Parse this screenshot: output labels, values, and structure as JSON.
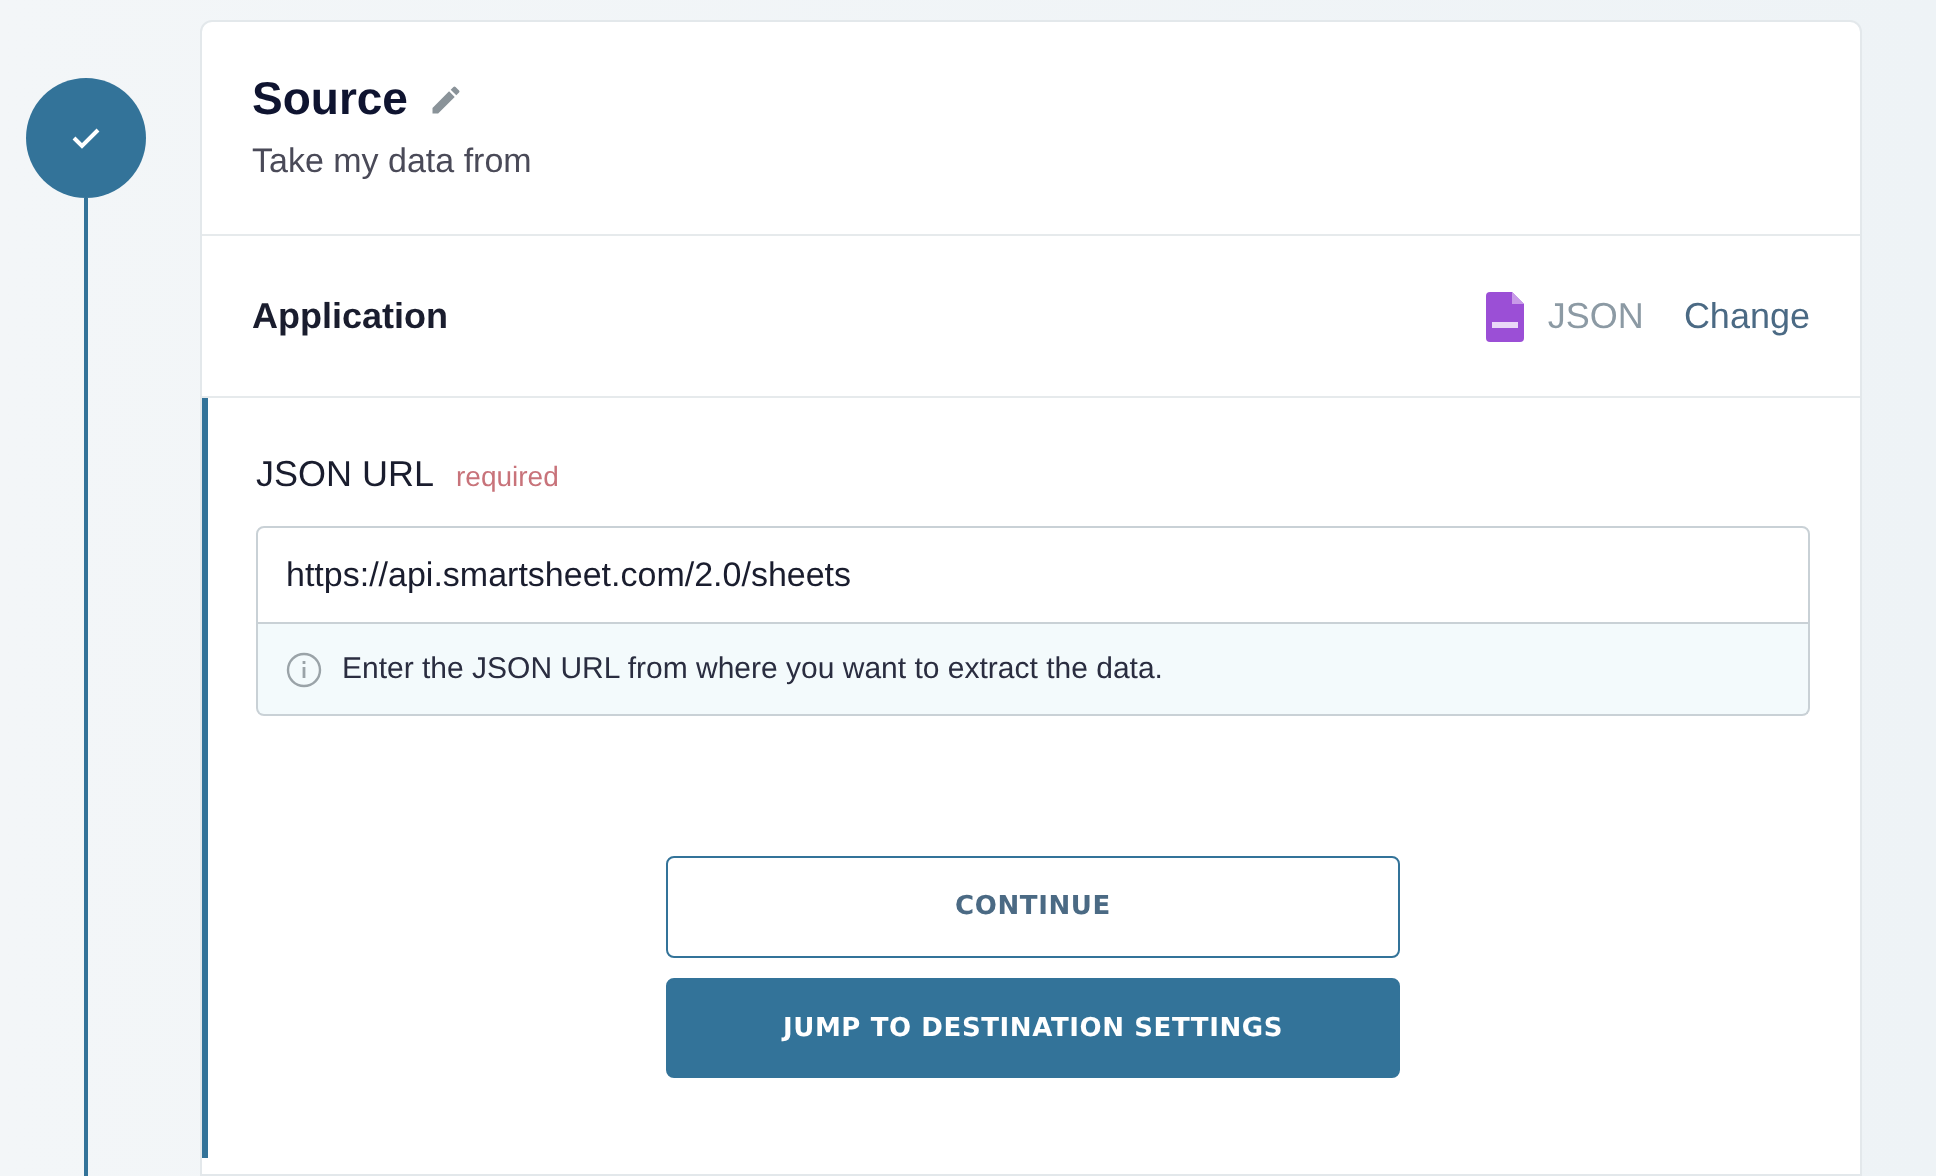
{
  "step": {
    "completed": true
  },
  "header": {
    "title": "Source",
    "subtitle": "Take my data from"
  },
  "application": {
    "label": "Application",
    "value": "JSON",
    "change_link": "Change"
  },
  "field": {
    "label": "JSON URL",
    "required": true,
    "required_text": "required",
    "value": "https://api.smartsheet.com/2.0/sheets",
    "hint": "Enter the JSON URL from where you want to extract the data."
  },
  "buttons": [
    {
      "label": "CONTINUE",
      "kind": "outline"
    },
    {
      "label": "JUMP TO DESTINATION SETTINGS",
      "kind": "primary"
    }
  ]
}
